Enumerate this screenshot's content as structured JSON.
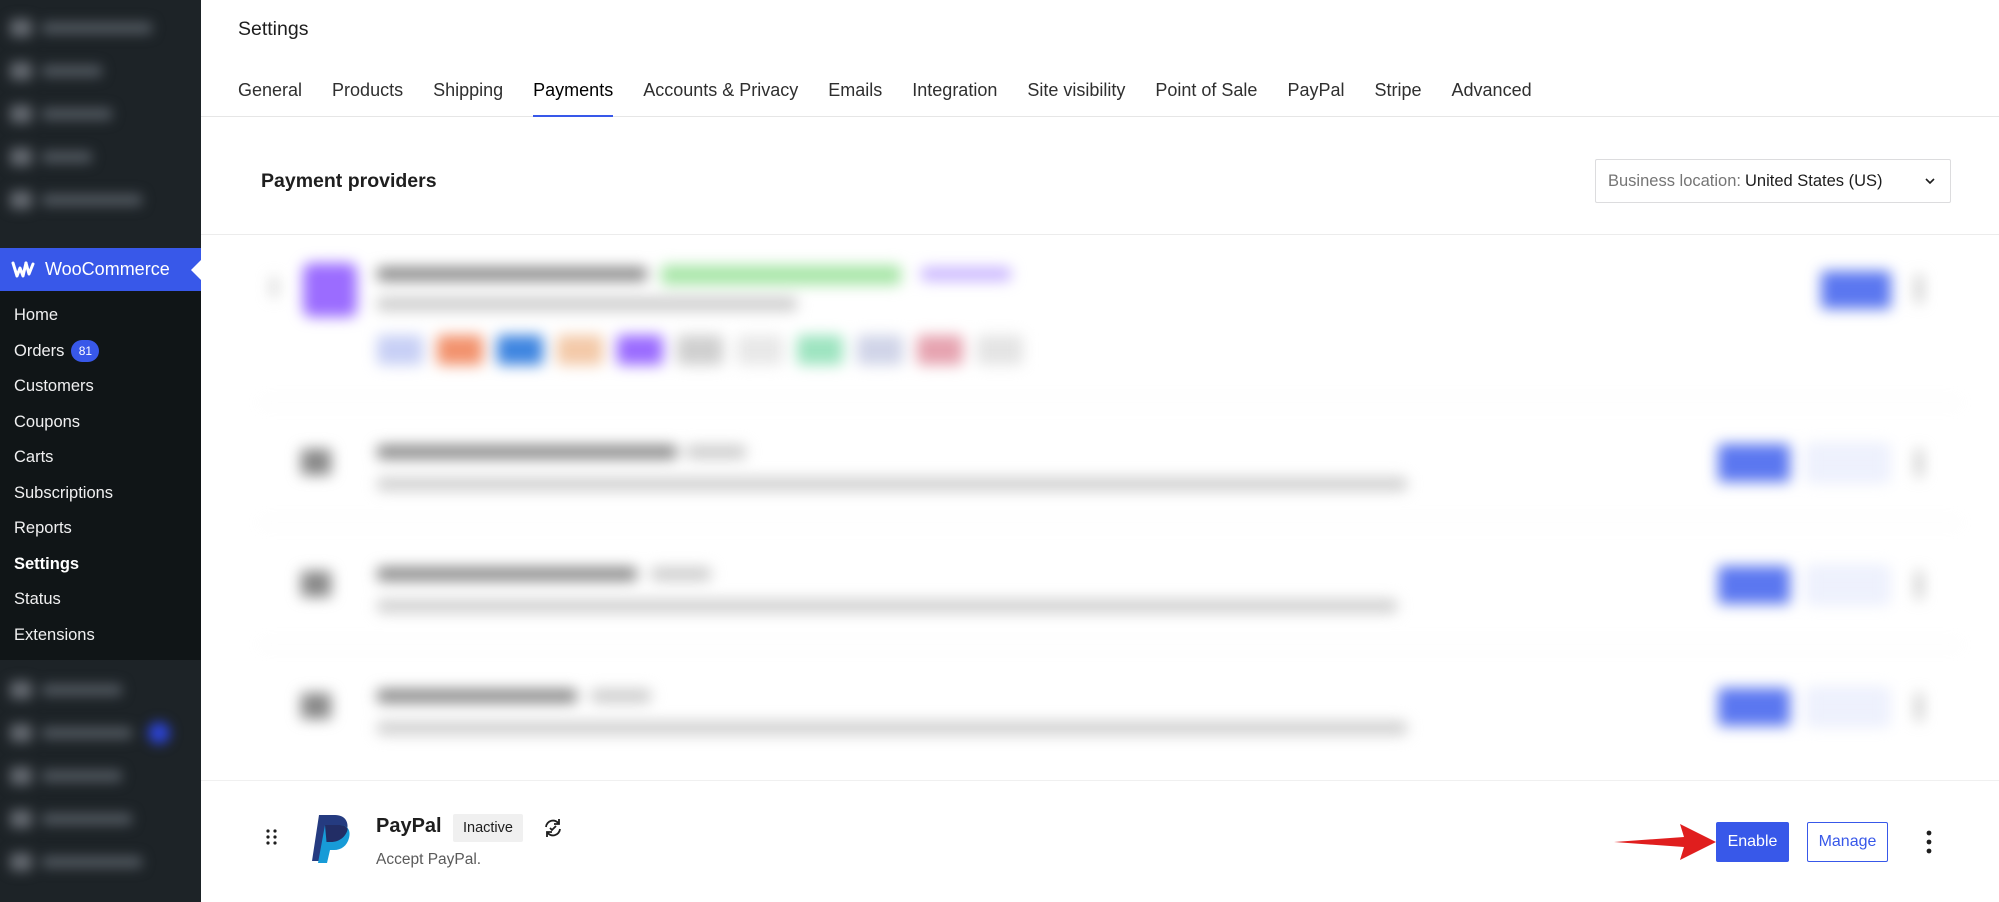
{
  "sidebar": {
    "section_title": "WooCommerce",
    "items": [
      {
        "label": "Home"
      },
      {
        "label": "Orders",
        "badge": "81"
      },
      {
        "label": "Customers"
      },
      {
        "label": "Coupons"
      },
      {
        "label": "Carts"
      },
      {
        "label": "Subscriptions"
      },
      {
        "label": "Reports"
      },
      {
        "label": "Settings",
        "active": true
      },
      {
        "label": "Status"
      },
      {
        "label": "Extensions"
      }
    ]
  },
  "header": {
    "title": "Settings",
    "tabs": [
      {
        "label": "General"
      },
      {
        "label": "Products"
      },
      {
        "label": "Shipping"
      },
      {
        "label": "Payments",
        "active": true
      },
      {
        "label": "Accounts & Privacy"
      },
      {
        "label": "Emails"
      },
      {
        "label": "Integration"
      },
      {
        "label": "Site visibility"
      },
      {
        "label": "Point of Sale"
      },
      {
        "label": "PayPal"
      },
      {
        "label": "Stripe"
      },
      {
        "label": "Advanced"
      }
    ]
  },
  "main": {
    "section_title": "Payment providers",
    "location": {
      "label": "Business location:",
      "value": "United States (US)"
    },
    "paypal": {
      "name": "PayPal",
      "status": "Inactive",
      "description": "Accept PayPal.",
      "enable_label": "Enable",
      "manage_label": "Manage"
    }
  },
  "colors": {
    "accent": "#3858e9",
    "sidebar_bg": "#1d2327",
    "submenu_bg": "#101517",
    "annotation_arrow": "#e01e1e"
  },
  "icons": {
    "logo": "woocommerce-logo-icon",
    "chevron": "chevron-down-icon",
    "drag": "drag-handle-icon",
    "sync": "sync-icon",
    "more": "more-vertical-icon",
    "brand": "paypal-logo-icon"
  }
}
